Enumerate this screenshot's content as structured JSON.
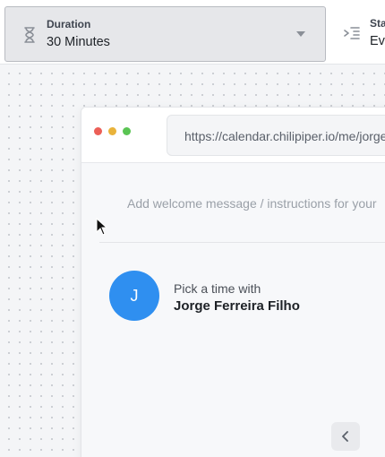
{
  "toolbar": {
    "duration": {
      "label": "Duration",
      "value": "30 Minutes",
      "icon": "hourglass-icon"
    },
    "start": {
      "label": "Sta",
      "value": "Ev",
      "icon": "indent-icon"
    }
  },
  "browser": {
    "url": "https://calendar.chilipiper.io/me/jorge",
    "welcome_placeholder": "Add welcome message / instructions for your",
    "host": {
      "initial": "J",
      "pick_label": "Pick a time with",
      "name": "Jorge Ferreira Filho"
    }
  },
  "colors": {
    "avatar": "#2f8ff0",
    "dot_red": "#ec5f57",
    "dot_yellow": "#e9b33b",
    "dot_green": "#5ac453"
  }
}
